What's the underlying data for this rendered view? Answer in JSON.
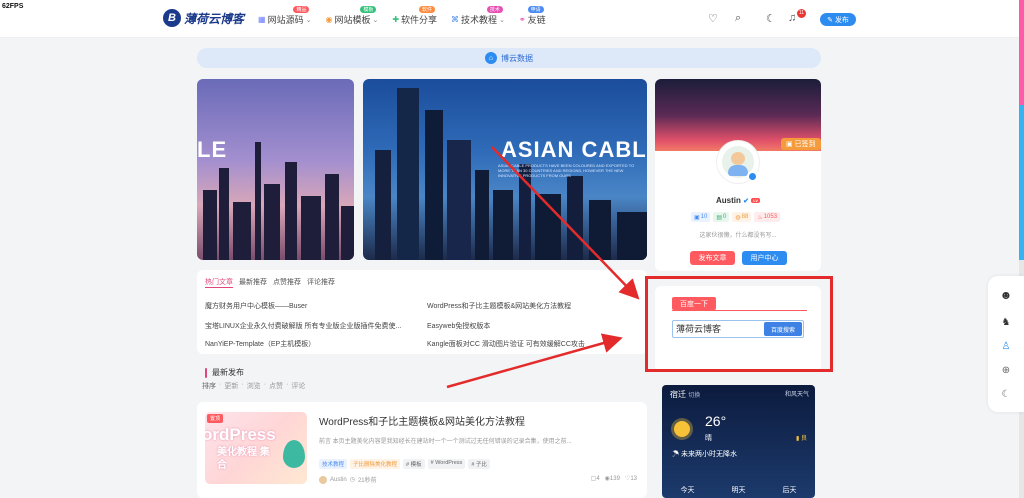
{
  "fps": "62FPS",
  "header": {
    "logo_text": "薄荷云博客",
    "nav": [
      {
        "label": "网站源码",
        "badge": "精品",
        "badge_color": "#ff5a5f"
      },
      {
        "label": "网站模板",
        "badge": "模板",
        "badge_color": "#35c07b"
      },
      {
        "label": "软件分享",
        "badge": "软件",
        "badge_color": "#ff8a3c"
      },
      {
        "label": "技术教程",
        "badge": "技术",
        "badge_color": "#e84eb3"
      },
      {
        "label": "友链",
        "badge": "申请",
        "badge_color": "#4a8cf2"
      }
    ],
    "bell_count": "11",
    "publish_label": "发布"
  },
  "announcement": "博云数据",
  "slides": {
    "slide1_text": "LE",
    "slide2_text": "ASIAN CABL",
    "slide2_sub": "ASIAN CABLE PRODUCTS HAVE BEEN COLOURED AND EXPORTED TO MORE THAN 30 COUNTRIES AND REGIONS, HOWEVER THE NEW INNOVATIVE PRODUCTS FROM OURS"
  },
  "profile": {
    "signed_label": "已签到",
    "username": "Austin",
    "stats": [
      {
        "icon": "▣",
        "value": "10",
        "color": "#4a8cf2",
        "bg": "#eaf2fe"
      },
      {
        "icon": "▤",
        "value": "0",
        "color": "#35b06b",
        "bg": "#e8f7ee"
      },
      {
        "icon": "◍",
        "value": "88",
        "color": "#f29b3c",
        "bg": "#fef3e6"
      },
      {
        "icon": "♨",
        "value": "1053",
        "color": "#ff5a5f",
        "bg": "#ffecec"
      }
    ],
    "description": "这家伙很懒，什么都没有写...",
    "publish_article": "发布文章",
    "user_center": "用户中心"
  },
  "hot": {
    "tabs": [
      "热门文章",
      "最新推荐",
      "点赞推荐",
      "评论推荐"
    ],
    "left_items": [
      "魔方财务用户中心模板——Buser",
      "宝塔LINUX企业永久付费破解版 所有专业版企业版插件免费使...",
      "NanYiEP-Template（EP主机模板）"
    ],
    "right_items": [
      "WordPress和子比主题模板&网站美化方法教程",
      "Easyweb免授权版本",
      "Kangle面板对CC 滑动图片验证 可有效缓解CC攻击"
    ]
  },
  "latest": {
    "title": "最新发布",
    "sort_label": "排序",
    "sorts": [
      "更新",
      "浏览",
      "点赞",
      "评论"
    ]
  },
  "post": {
    "thumb_tag": "置顶",
    "thumb_line1": "ordPress",
    "thumb_line2": "美化教程 集合",
    "title": "WordPress和子比主题模板&网站美化方法教程",
    "excerpt": "前言 本页主题美化内容是我知经长在建站时一个一个测试过无任何错误的记录合集，使用之前...",
    "tags": [
      {
        "label": "技术教程",
        "color": "#4a8cf2"
      },
      {
        "label": "子比删除美化教程",
        "color": "#f29b3c"
      },
      {
        "label": "# 模板",
        "color": "#666"
      },
      {
        "label": "# WordPress",
        "color": "#666"
      },
      {
        "label": "# 子比",
        "color": "#666"
      }
    ],
    "author": "Austin",
    "time": "21秒前",
    "comments": "4",
    "views": "139",
    "likes": "13"
  },
  "search": {
    "tab_label": "百度一下",
    "input_value": "薄荷云博客",
    "button_label": "百度搜索"
  },
  "weather": {
    "city": "宿迁",
    "switch": "切换",
    "brand": "和风天气",
    "temp": "26°",
    "cond": "晴",
    "aqi": "良",
    "forecast": "未来两小时无降水",
    "days": [
      "今天",
      "明天",
      "后天"
    ]
  }
}
